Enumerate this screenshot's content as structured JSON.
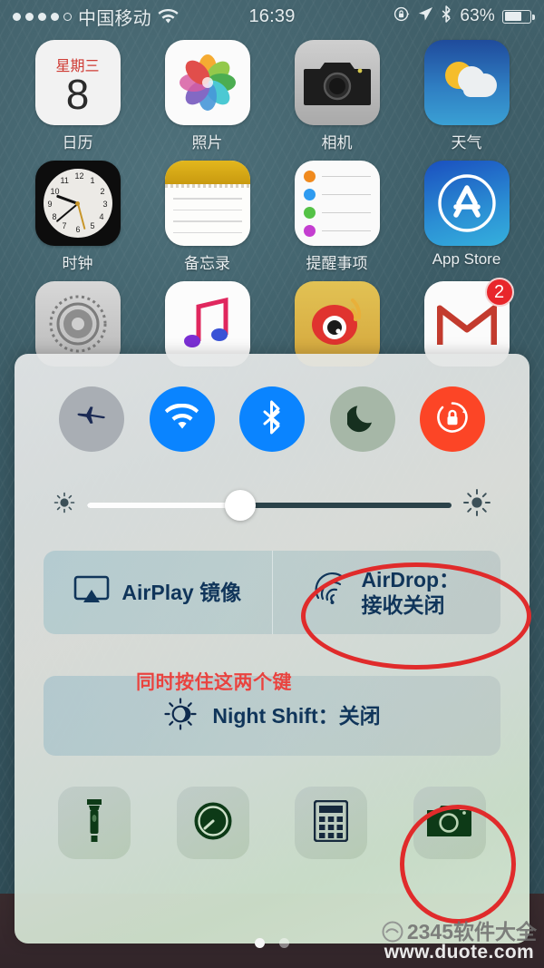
{
  "status_bar": {
    "signal_dots_filled": 4,
    "signal_dots_total": 5,
    "carrier": "中国移动",
    "wifi_icon": "wifi-icon",
    "time": "16:39",
    "rotation_lock_icon": "rotation-lock-icon",
    "location_icon": "location-arrow-icon",
    "bluetooth_icon": "bluetooth-icon",
    "battery_percent": "63%",
    "battery_level": 63
  },
  "home_screen": {
    "rows": [
      [
        {
          "label": "日历",
          "icon": "calendar-icon",
          "calendar_weekday": "星期三",
          "calendar_day": "8"
        },
        {
          "label": "照片",
          "icon": "photos-icon"
        },
        {
          "label": "相机",
          "icon": "camera-icon"
        },
        {
          "label": "天气",
          "icon": "weather-icon"
        }
      ],
      [
        {
          "label": "时钟",
          "icon": "clock-icon"
        },
        {
          "label": "备忘录",
          "icon": "notes-icon"
        },
        {
          "label": "提醒事项",
          "icon": "reminders-icon"
        },
        {
          "label": "App Store",
          "icon": "app-store-icon"
        }
      ],
      [
        {
          "label": "",
          "icon": "settings-icon"
        },
        {
          "label": "",
          "icon": "music-icon"
        },
        {
          "label": "",
          "icon": "weibo-icon"
        },
        {
          "label": "",
          "icon": "gmail-icon",
          "badge": "2"
        }
      ]
    ]
  },
  "control_center": {
    "toggles": [
      {
        "name": "airplane-mode",
        "icon": "airplane-icon",
        "state": "off",
        "color": "#a9aeb4"
      },
      {
        "name": "wifi",
        "icon": "wifi-icon",
        "state": "on",
        "color": "#0a84ff"
      },
      {
        "name": "bluetooth",
        "icon": "bluetooth-icon",
        "state": "on",
        "color": "#0a84ff"
      },
      {
        "name": "do-not-disturb",
        "icon": "moon-icon",
        "state": "off",
        "color": "#a6b7a7"
      },
      {
        "name": "rotation-lock",
        "icon": "rotation-lock-icon",
        "state": "on",
        "color": "#fc4526"
      }
    ],
    "brightness": {
      "value_percent": 42,
      "low_icon": "brightness-low-icon",
      "high_icon": "brightness-high-icon"
    },
    "airplay_label": "AirPlay 镜像",
    "airplay_icon": "airplay-mirroring-icon",
    "airdrop_label_line1": "AirDrop：",
    "airdrop_label_line2": "接收关闭",
    "airdrop_icon": "airdrop-icon",
    "night_shift_label": "Night Shift：关闭",
    "night_shift_icon": "night-shift-icon",
    "shortcuts": [
      {
        "name": "flashlight",
        "icon": "flashlight-icon"
      },
      {
        "name": "timer",
        "icon": "timer-icon"
      },
      {
        "name": "calculator",
        "icon": "calculator-icon"
      },
      {
        "name": "camera",
        "icon": "camera-icon"
      }
    ]
  },
  "annotations": {
    "instruction_text": "同时按住这两个键",
    "instruction_color": "#e8433f",
    "circle_color": "#e02b2b",
    "circled_items": [
      "airdrop-button",
      "camera-shortcut"
    ]
  },
  "page_indicator": {
    "total": 2,
    "active_index": 0
  },
  "watermark": {
    "brand": "2345软件大全",
    "url": "www.duote.com"
  }
}
